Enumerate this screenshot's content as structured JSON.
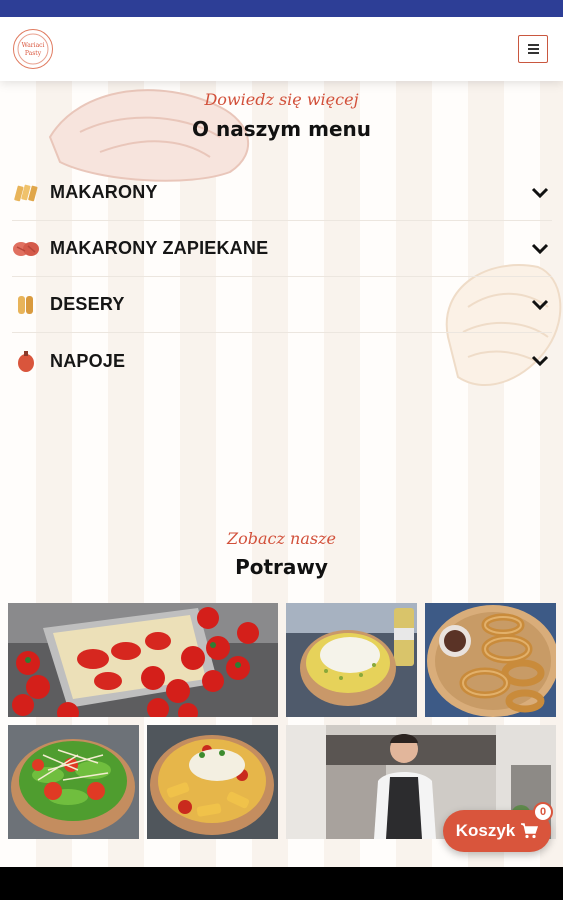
{
  "header": {
    "logo_text": "Wariaci Pasty",
    "menu_icon": "hamburger-icon"
  },
  "menu_section": {
    "subtitle": "Dowiedz się więcej",
    "title": "O naszym menu",
    "items": [
      {
        "label": "MAKARONY",
        "icon": "pasta-icon"
      },
      {
        "label": "MAKARONY ZAPIEKANE",
        "icon": "baked-pasta-icon"
      },
      {
        "label": "DESERY",
        "icon": "dessert-icon"
      },
      {
        "label": "NAPOJE",
        "icon": "drink-icon"
      }
    ]
  },
  "gallery_section": {
    "subtitle": "Zobacz nasze",
    "title": "Potrawy",
    "photos": [
      "lasagna-with-tomatoes-photo",
      "pasta-bowl-with-cheese-photo",
      "churros-with-dip-photo",
      "salad-bowl-photo",
      "penne-bowl-photo",
      "chef-in-kitchen-photo"
    ]
  },
  "cart": {
    "label": "Koszyk",
    "count": "0",
    "icon": "cart-icon"
  },
  "colors": {
    "accent": "#d9553c",
    "status_bar": "#2d3e96",
    "subtitle": "#d2503a"
  }
}
